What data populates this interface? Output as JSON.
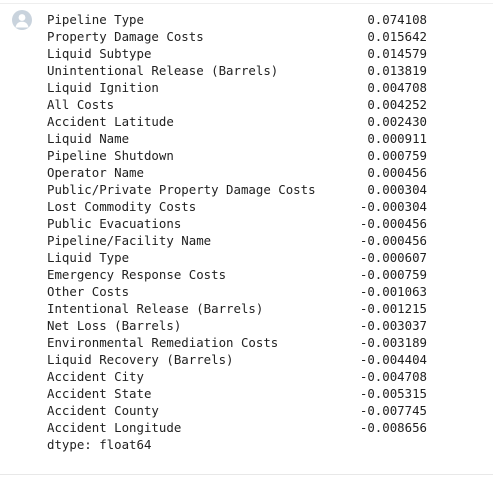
{
  "output": {
    "rows": [
      {
        "label": "Pipeline Type",
        "value": "0.074108"
      },
      {
        "label": "Property Damage Costs",
        "value": "0.015642"
      },
      {
        "label": "Liquid Subtype",
        "value": "0.014579"
      },
      {
        "label": "Unintentional Release (Barrels)",
        "value": "0.013819"
      },
      {
        "label": "Liquid Ignition",
        "value": "0.004708"
      },
      {
        "label": "All Costs",
        "value": "0.004252"
      },
      {
        "label": "Accident Latitude",
        "value": "0.002430"
      },
      {
        "label": "Liquid Name",
        "value": "0.000911"
      },
      {
        "label": "Pipeline Shutdown",
        "value": "0.000759"
      },
      {
        "label": "Operator Name",
        "value": "0.000456"
      },
      {
        "label": "Public/Private Property Damage Costs",
        "value": "0.000304"
      },
      {
        "label": "Lost Commodity Costs",
        "value": "-0.000304"
      },
      {
        "label": "Public Evacuations",
        "value": "-0.000456"
      },
      {
        "label": "Pipeline/Facility Name",
        "value": "-0.000456"
      },
      {
        "label": "Liquid Type",
        "value": "-0.000607"
      },
      {
        "label": "Emergency Response Costs",
        "value": "-0.000759"
      },
      {
        "label": "Other Costs",
        "value": "-0.001063"
      },
      {
        "label": "Intentional Release (Barrels)",
        "value": "-0.001215"
      },
      {
        "label": "Net Loss (Barrels)",
        "value": "-0.003037"
      },
      {
        "label": "Environmental Remediation Costs",
        "value": "-0.003189"
      },
      {
        "label": "Liquid Recovery (Barrels)",
        "value": "-0.004404"
      },
      {
        "label": "Accident City",
        "value": "-0.004708"
      },
      {
        "label": "Accident State",
        "value": "-0.005315"
      },
      {
        "label": "Accident County",
        "value": "-0.007745"
      },
      {
        "label": "Accident Longitude",
        "value": "-0.008656"
      }
    ],
    "dtype": "dtype: float64"
  },
  "icons": {
    "avatar": "user-avatar-icon"
  },
  "colors": {
    "avatar_bg": "#c9d3dd",
    "avatar_fg": "#ffffff",
    "text": "#212121"
  }
}
